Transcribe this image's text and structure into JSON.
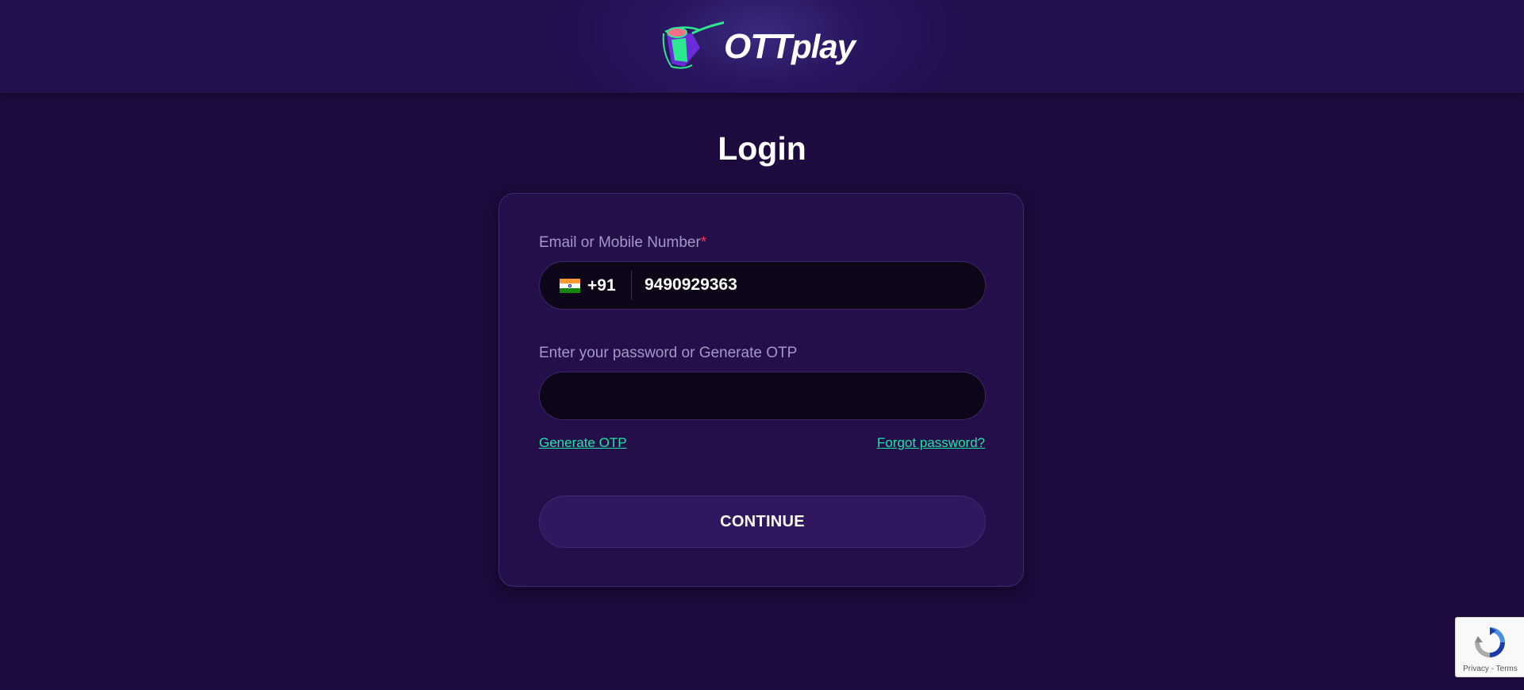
{
  "header": {
    "logo_text_primary": "OTT",
    "logo_text_secondary": "play"
  },
  "page": {
    "title": "Login"
  },
  "form": {
    "email_label": "Email or Mobile Number",
    "required_mark": "*",
    "country_flag": "india-flag",
    "country_code": "+91",
    "phone_value": "9490929363",
    "password_label": "Enter your password or Generate OTP",
    "password_value": "",
    "generate_otp_label": "Generate OTP",
    "forgot_password_label": "Forgot password?",
    "continue_label": "CONTINUE"
  },
  "recaptcha": {
    "privacy_label": "Privacy",
    "separator": " - ",
    "terms_label": "Terms"
  },
  "colors": {
    "background": "#1d0a3e",
    "card": "#240f4b",
    "input_background": "#0d0518",
    "link": "#1de6a3",
    "label": "#a896c6",
    "required": "#ff3355",
    "button": "#31175e"
  }
}
